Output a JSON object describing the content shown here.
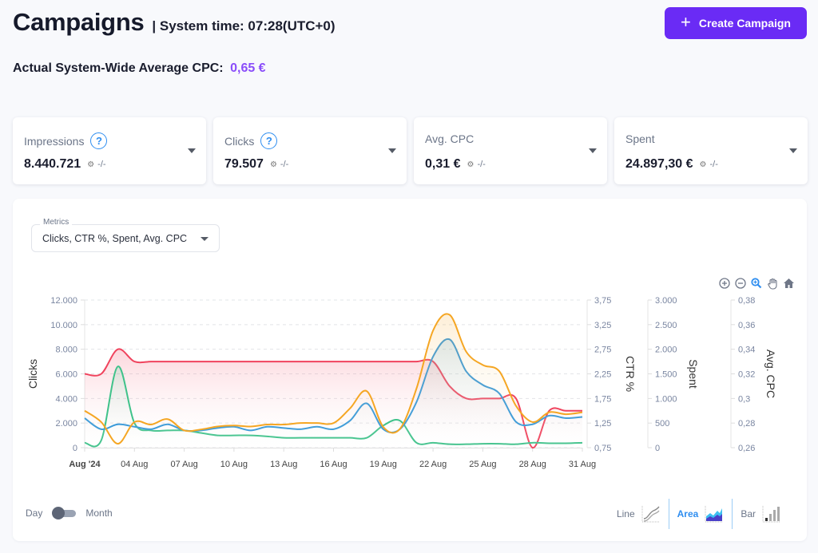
{
  "header": {
    "title": "Campaigns",
    "system_time": "| System time: 07:28(UTC+0)",
    "create_button": "Create Campaign",
    "avg_cpc_label": "Actual System-Wide Average CPC:",
    "avg_cpc_value": "0,65 €"
  },
  "kpis": [
    {
      "label": "Impressions",
      "has_help": true,
      "value": "8.440.721",
      "comparison": "-/-"
    },
    {
      "label": "Clicks",
      "has_help": true,
      "value": "79.507",
      "comparison": "-/-"
    },
    {
      "label": "Avg. CPC",
      "has_help": false,
      "value": "0,31 €",
      "comparison": "-/-"
    },
    {
      "label": "Spent",
      "has_help": false,
      "value": "24.897,30 €",
      "comparison": "-/-"
    }
  ],
  "metrics_select": {
    "label": "Metrics",
    "value": "Clicks, CTR %, Spent, Avg. CPC"
  },
  "toolbar": [
    "zoom-in",
    "zoom-out",
    "selection-zoom",
    "pan",
    "reset-home"
  ],
  "period_toggle": {
    "left": "Day",
    "right": "Month",
    "selected": "Day"
  },
  "chart_types": [
    {
      "label": "Line",
      "active": false
    },
    {
      "label": "Area",
      "active": true
    },
    {
      "label": "Bar",
      "active": false
    }
  ],
  "colors": {
    "accent": "#6a2bf5",
    "highlight_value": "#8a4dfa",
    "clicks": "#3a9ad9",
    "ctr": "#3fc28a",
    "spent": "#f5a623",
    "avg_cpc": "#f0435d",
    "link_blue": "#2f8ef0"
  },
  "chart_data": {
    "type": "area",
    "x_tick_labels": [
      "Aug '24",
      "04 Aug",
      "07 Aug",
      "10 Aug",
      "13 Aug",
      "16 Aug",
      "19 Aug",
      "22 Aug",
      "25 Aug",
      "28 Aug",
      "31 Aug"
    ],
    "x_tick_days": [
      1,
      4,
      7,
      10,
      13,
      16,
      19,
      22,
      25,
      28,
      31
    ],
    "x": [
      1,
      2,
      3,
      4,
      5,
      6,
      7,
      8,
      9,
      10,
      11,
      12,
      13,
      14,
      15,
      16,
      17,
      18,
      19,
      20,
      21,
      22,
      23,
      24,
      25,
      26,
      27,
      28,
      29,
      30,
      31
    ],
    "axes": [
      {
        "id": "clicks",
        "title": "Clicks",
        "side": "left",
        "range": [
          0,
          12000
        ],
        "ticks": [
          "0",
          "2.000",
          "4.000",
          "6.000",
          "8.000",
          "10.000",
          "12.000"
        ]
      },
      {
        "id": "ctr",
        "title": "CTR %",
        "side": "right",
        "range": [
          0.75,
          3.75
        ],
        "ticks": [
          "0,75",
          "1,25",
          "1,75",
          "2,25",
          "2,75",
          "3,25",
          "3,75"
        ]
      },
      {
        "id": "spent",
        "title": "Spent",
        "side": "right",
        "range": [
          0,
          3000
        ],
        "ticks": [
          "0",
          "500",
          "1.000",
          "1.500",
          "2.000",
          "2.500",
          "3.000"
        ]
      },
      {
        "id": "avg_cpc",
        "title": "Avg. CPC",
        "side": "right",
        "range": [
          0.26,
          0.38
        ],
        "ticks": [
          "0,26",
          "0,28",
          "0,3",
          "0,32",
          "0,34",
          "0,36",
          "0,38"
        ]
      }
    ],
    "series": [
      {
        "name": "Avg. CPC",
        "axis": "avg_cpc",
        "values": [
          0.32,
          0.32,
          0.34,
          0.33,
          0.33,
          0.33,
          0.33,
          0.33,
          0.33,
          0.33,
          0.33,
          0.33,
          0.33,
          0.33,
          0.33,
          0.33,
          0.33,
          0.33,
          0.33,
          0.33,
          0.33,
          0.33,
          0.31,
          0.3,
          0.3,
          0.3,
          0.3,
          0.26,
          0.29,
          0.29,
          0.29
        ]
      },
      {
        "name": "Spent",
        "axis": "spent",
        "values": [
          750,
          520,
          80,
          520,
          470,
          580,
          350,
          370,
          430,
          450,
          430,
          470,
          470,
          500,
          500,
          500,
          800,
          1150,
          420,
          380,
          1200,
          2380,
          2700,
          1950,
          1680,
          1550,
          850,
          520,
          720,
          680,
          720
        ]
      },
      {
        "name": "Clicks",
        "axis": "clicks",
        "values": [
          2400,
          1500,
          1900,
          1700,
          1500,
          1900,
          1400,
          1400,
          1600,
          1700,
          1400,
          1700,
          1600,
          1500,
          1700,
          1500,
          2200,
          3600,
          1500,
          1500,
          3700,
          7400,
          8800,
          6200,
          5100,
          4400,
          2100,
          1900,
          2600,
          2400,
          2500
        ]
      },
      {
        "name": "CTR %",
        "axis": "ctr",
        "values": [
          0.85,
          0.9,
          2.4,
          1.25,
          1.1,
          1.1,
          1.1,
          1.05,
          1.0,
          1.0,
          1.0,
          0.98,
          0.95,
          0.95,
          0.95,
          0.95,
          0.95,
          0.95,
          1.2,
          1.3,
          0.85,
          0.85,
          0.82,
          0.82,
          0.83,
          0.83,
          0.82,
          0.85,
          0.84,
          0.84,
          0.85
        ]
      }
    ],
    "grid": true,
    "legend": "none"
  }
}
